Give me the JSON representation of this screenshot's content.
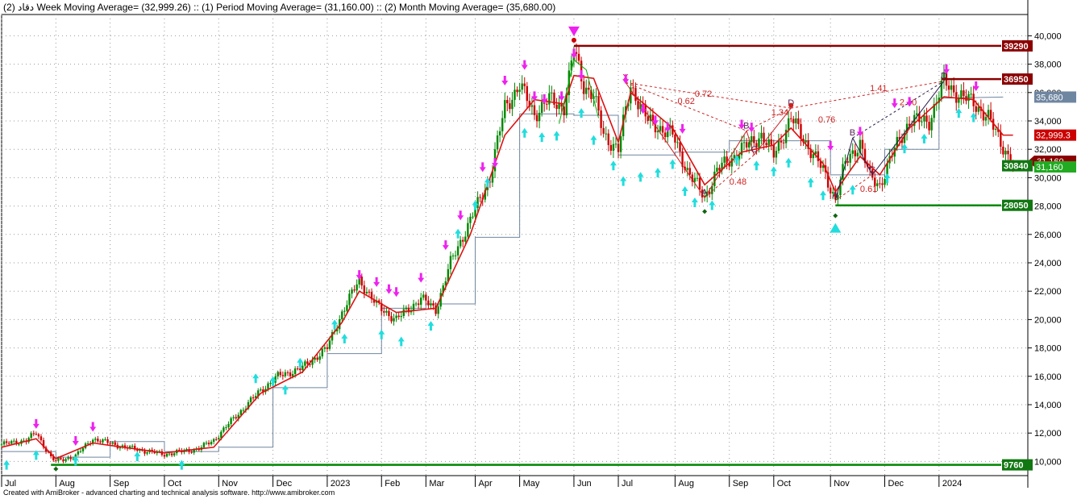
{
  "header": {
    "title": "دقاد (2) Week Moving Average= (32,999.26) :: (1) Period Moving Average= (31,160.00) :: (2) Month Moving Average= (35,680.00)"
  },
  "footer": {
    "credit": "Created with AmiBroker - advanced charting and technical analysis software. http://www.amibroker.com"
  },
  "colors": {
    "weekMA": "#dd1111",
    "periodMA": "#00aa00",
    "monthMA": "#6f86a0",
    "upCandle": "#008800",
    "downCandle": "#cc0000",
    "sellArrow": "#ee22ee",
    "buyArrow": "#22dddd",
    "support": "#008800",
    "resistance": "#8b0000",
    "pattern": "#cc2222"
  },
  "chart_data": {
    "type": "candlestick",
    "yrange": [
      9000,
      41500
    ],
    "yticks": [
      {
        "v": 10000,
        "label": "10,000"
      },
      {
        "v": 12000,
        "label": "12,000"
      },
      {
        "v": 14000,
        "label": "14,000"
      },
      {
        "v": 16000,
        "label": "16,000"
      },
      {
        "v": 18000,
        "label": "18,000"
      },
      {
        "v": 20000,
        "label": "20,000"
      },
      {
        "v": 22000,
        "label": "22,000"
      },
      {
        "v": 24000,
        "label": "24,000"
      },
      {
        "v": 26000,
        "label": "26,000"
      },
      {
        "v": 28000,
        "label": "28,000"
      },
      {
        "v": 30000,
        "label": "30,000"
      },
      {
        "v": 32000,
        "label": "32,000"
      },
      {
        "v": 34000,
        "label": "34,000"
      },
      {
        "v": 36000,
        "label": "36,000"
      },
      {
        "v": 38000,
        "label": "38,000"
      },
      {
        "v": 40000,
        "label": "40,000"
      }
    ],
    "xrange": [
      0,
      416
    ],
    "xticks": [
      {
        "i": 0,
        "label": "Jul"
      },
      {
        "i": 22,
        "label": "Aug"
      },
      {
        "i": 44,
        "label": "Sep"
      },
      {
        "i": 66,
        "label": "Oct"
      },
      {
        "i": 88,
        "label": "Nov"
      },
      {
        "i": 110,
        "label": "Dec"
      },
      {
        "i": 132,
        "label": "2023"
      },
      {
        "i": 154,
        "label": "Feb"
      },
      {
        "i": 172,
        "label": "Mar"
      },
      {
        "i": 192,
        "label": "Apr"
      },
      {
        "i": 210,
        "label": "May"
      },
      {
        "i": 232,
        "label": "Jun"
      },
      {
        "i": 250,
        "label": "Jul"
      },
      {
        "i": 273,
        "label": "Aug"
      },
      {
        "i": 295,
        "label": "Sep"
      },
      {
        "i": 313,
        "label": "Oct"
      },
      {
        "i": 336,
        "label": "Nov"
      },
      {
        "i": 358,
        "label": "Dec"
      },
      {
        "i": 380,
        "label": "2024"
      }
    ],
    "close": [
      [
        0,
        11200
      ],
      [
        10,
        11500
      ],
      [
        14,
        12000
      ],
      [
        20,
        10300
      ],
      [
        22,
        10000
      ],
      [
        30,
        10400
      ],
      [
        37,
        11600
      ],
      [
        50,
        11000
      ],
      [
        66,
        10500
      ],
      [
        80,
        10900
      ],
      [
        86,
        11500
      ],
      [
        95,
        13200
      ],
      [
        105,
        15000
      ],
      [
        112,
        16000
      ],
      [
        122,
        16600
      ],
      [
        132,
        18000
      ],
      [
        138,
        20500
      ],
      [
        145,
        22800
      ],
      [
        152,
        21000
      ],
      [
        160,
        20000
      ],
      [
        170,
        21500
      ],
      [
        176,
        20700
      ],
      [
        182,
        24000
      ],
      [
        190,
        27000
      ],
      [
        198,
        30000
      ],
      [
        204,
        35000
      ],
      [
        210,
        36500
      ],
      [
        216,
        34500
      ],
      [
        222,
        35500
      ],
      [
        228,
        35000
      ],
      [
        232,
        39000
      ],
      [
        236,
        36500
      ],
      [
        240,
        35800
      ],
      [
        244,
        33000
      ],
      [
        250,
        32000
      ],
      [
        255,
        36500
      ],
      [
        262,
        34000
      ],
      [
        272,
        33000
      ],
      [
        278,
        30500
      ],
      [
        285,
        28600
      ],
      [
        290,
        30500
      ],
      [
        300,
        32000
      ],
      [
        308,
        33000
      ],
      [
        313,
        31600
      ],
      [
        320,
        34200
      ],
      [
        326,
        32500
      ],
      [
        333,
        30500
      ],
      [
        338,
        28500
      ],
      [
        342,
        31000
      ],
      [
        348,
        32500
      ],
      [
        352,
        30000
      ],
      [
        356,
        29500
      ],
      [
        362,
        32000
      ],
      [
        368,
        34000
      ],
      [
        376,
        34000
      ],
      [
        382,
        36800
      ],
      [
        388,
        35800
      ],
      [
        394,
        35300
      ],
      [
        400,
        34200
      ],
      [
        406,
        32200
      ],
      [
        410,
        30900
      ]
    ],
    "weekMA": [
      [
        0,
        11000
      ],
      [
        14,
        11600
      ],
      [
        22,
        10200
      ],
      [
        37,
        11300
      ],
      [
        66,
        10600
      ],
      [
        86,
        11000
      ],
      [
        105,
        14800
      ],
      [
        122,
        16300
      ],
      [
        138,
        19800
      ],
      [
        145,
        22000
      ],
      [
        160,
        20500
      ],
      [
        176,
        20800
      ],
      [
        190,
        26000
      ],
      [
        204,
        33000
      ],
      [
        216,
        35500
      ],
      [
        228,
        35200
      ],
      [
        232,
        37200
      ],
      [
        240,
        37000
      ],
      [
        250,
        32500
      ],
      [
        255,
        36000
      ],
      [
        272,
        33500
      ],
      [
        285,
        29500
      ],
      [
        300,
        31800
      ],
      [
        313,
        32300
      ],
      [
        320,
        33500
      ],
      [
        333,
        31000
      ],
      [
        338,
        29000
      ],
      [
        348,
        31500
      ],
      [
        356,
        30200
      ],
      [
        368,
        33500
      ],
      [
        382,
        35700
      ],
      [
        394,
        35500
      ],
      [
        406,
        33000
      ],
      [
        410,
        32999
      ]
    ],
    "periodMA": [
      [
        226,
        33800
      ],
      [
        232,
        38300
      ],
      [
        237,
        37600
      ],
      [
        242,
        34200
      ]
    ],
    "monthMA": [
      [
        0,
        10700
      ],
      [
        22,
        10700
      ],
      [
        22,
        10300
      ],
      [
        44,
        10300
      ],
      [
        44,
        11400
      ],
      [
        66,
        11400
      ],
      [
        66,
        10700
      ],
      [
        88,
        10700
      ],
      [
        88,
        11000
      ],
      [
        110,
        11000
      ],
      [
        110,
        15200
      ],
      [
        132,
        15200
      ],
      [
        132,
        17600
      ],
      [
        154,
        17600
      ],
      [
        154,
        20800
      ],
      [
        172,
        20800
      ],
      [
        172,
        21100
      ],
      [
        192,
        21100
      ],
      [
        192,
        25800
      ],
      [
        210,
        25800
      ],
      [
        210,
        34500
      ],
      [
        232,
        34500
      ],
      [
        232,
        34400
      ],
      [
        250,
        34400
      ],
      [
        250,
        31600
      ],
      [
        273,
        31600
      ],
      [
        273,
        31800
      ],
      [
        295,
        31800
      ],
      [
        295,
        32600
      ],
      [
        313,
        32600
      ],
      [
        313,
        32600
      ],
      [
        336,
        32600
      ],
      [
        336,
        30200
      ],
      [
        358,
        30200
      ],
      [
        358,
        32000
      ],
      [
        380,
        32000
      ],
      [
        380,
        35600
      ],
      [
        406,
        35680
      ]
    ],
    "sellSignals": [
      [
        14,
        12300
      ],
      [
        30,
        11100
      ],
      [
        37,
        12100
      ],
      [
        145,
        22800
      ],
      [
        152,
        22300
      ],
      [
        157,
        21800
      ],
      [
        160,
        21600
      ],
      [
        170,
        22600
      ],
      [
        180,
        24900
      ],
      [
        186,
        27000
      ],
      [
        195,
        30400
      ],
      [
        200,
        30700
      ],
      [
        204,
        36500
      ],
      [
        212,
        37600
      ],
      [
        216,
        35400
      ],
      [
        220,
        35200
      ],
      [
        227,
        35400
      ],
      [
        232,
        38400
      ],
      [
        235,
        36900
      ],
      [
        253,
        36600
      ],
      [
        260,
        34500
      ],
      [
        265,
        33700
      ],
      [
        270,
        33200
      ],
      [
        276,
        33100
      ],
      [
        300,
        33400
      ],
      [
        304,
        33200
      ],
      [
        336,
        31900
      ],
      [
        348,
        32900
      ],
      [
        362,
        34900
      ],
      [
        368,
        35000
      ],
      [
        383,
        37300
      ],
      [
        395,
        36100
      ]
    ],
    "buySignals": [
      [
        2,
        10100
      ],
      [
        14,
        10800
      ],
      [
        30,
        10400
      ],
      [
        55,
        10700
      ],
      [
        73,
        10100
      ],
      [
        103,
        16200
      ],
      [
        110,
        16000
      ],
      [
        115,
        15400
      ],
      [
        121,
        17300
      ],
      [
        135,
        20000
      ],
      [
        139,
        19000
      ],
      [
        154,
        19300
      ],
      [
        162,
        18800
      ],
      [
        174,
        19900
      ],
      [
        185,
        26400
      ],
      [
        192,
        28400
      ],
      [
        197,
        30000
      ],
      [
        212,
        33500
      ],
      [
        219,
        33200
      ],
      [
        225,
        33300
      ],
      [
        235,
        34900
      ],
      [
        240,
        33000
      ],
      [
        248,
        31200
      ],
      [
        252,
        30100
      ],
      [
        259,
        30400
      ],
      [
        266,
        30700
      ],
      [
        272,
        31300
      ],
      [
        277,
        29400
      ],
      [
        281,
        28600
      ],
      [
        288,
        28400
      ],
      [
        298,
        31600
      ],
      [
        306,
        31200
      ],
      [
        313,
        30800
      ],
      [
        319,
        31400
      ],
      [
        328,
        30000
      ],
      [
        333,
        29100
      ],
      [
        345,
        29500
      ],
      [
        359,
        30300
      ],
      [
        366,
        32400
      ],
      [
        374,
        33100
      ],
      [
        388,
        34900
      ],
      [
        394,
        34600
      ]
    ],
    "supportLevels": [
      {
        "label": "9760",
        "from": 20,
        "to": 423,
        "value": 9760
      },
      {
        "label": "28050",
        "from": 338,
        "to": 423,
        "value": 28050
      }
    ],
    "resistanceLevels": [
      {
        "label": "39290",
        "from": 232,
        "to": 423,
        "value": 39290
      },
      {
        "label": "36950",
        "from": 381,
        "to": 423,
        "value": 36950
      }
    ],
    "extremeMarks": {
      "high": {
        "i": 232,
        "v": 39290
      },
      "low1": {
        "i": 22,
        "v": 9750
      },
      "low2": {
        "i": 285,
        "v": 27900
      },
      "low3": {
        "i": 338,
        "v": 27600
      }
    },
    "patternPoints": [
      {
        "label": "X",
        "i": 253,
        "v": 36700
      },
      {
        "label": "A",
        "i": 285,
        "v": 28600
      },
      {
        "label": "B",
        "i": 302,
        "v": 33300
      },
      {
        "label": "C",
        "i": 305,
        "v": 31600
      },
      {
        "label": "D",
        "i": 320,
        "v": 34900
      },
      {
        "label": "A",
        "i": 338,
        "v": 28400
      },
      {
        "label": "B",
        "i": 345,
        "v": 32800
      },
      {
        "label": "C",
        "i": 353,
        "v": 30200
      },
      {
        "label": "D",
        "i": 382,
        "v": 36800
      }
    ],
    "ratioLabels": [
      {
        "text": "0.72",
        "i": 281,
        "v": 35700
      },
      {
        "text": "0.62",
        "i": 274,
        "v": 35200
      },
      {
        "text": "0.48",
        "i": 295,
        "v": 29500
      },
      {
        "text": "1.34",
        "i": 312,
        "v": 34400
      },
      {
        "text": "0.76",
        "i": 331,
        "v": 33900
      },
      {
        "text": "1.41",
        "i": 352,
        "v": 36100
      },
      {
        "text": "0.61",
        "i": 348,
        "v": 29000
      },
      {
        "text": "2.40",
        "i": 364,
        "v": 35100
      }
    ],
    "priceTags": [
      {
        "text": "39290",
        "v": 39290,
        "bg": "#8b0000",
        "fg": "#ffffff"
      },
      {
        "text": "36950",
        "v": 36950,
        "bg": "#8b0000",
        "fg": "#ffffff"
      },
      {
        "text": "35,680",
        "v": 35680,
        "bg": "#6f86a0",
        "fg": "#ffffff"
      },
      {
        "text": "32,999.3",
        "v": 32999,
        "bg": "#cc0000",
        "fg": "#ffffff"
      },
      {
        "text": "31,160",
        "v": 31160,
        "bg": "#8b0000",
        "fg": "#ffffff"
      },
      {
        "text": "31,160",
        "v": 30760,
        "bg": "#22aa22",
        "fg": "#ffffff"
      },
      {
        "text": "30840",
        "v": 30840,
        "bg": "#117711",
        "fg": "#ffffff"
      },
      {
        "text": "28050",
        "v": 28050,
        "bg": "#117711",
        "fg": "#ffffff"
      },
      {
        "text": "9760",
        "v": 9760,
        "bg": "#117711",
        "fg": "#ffffff"
      }
    ]
  }
}
